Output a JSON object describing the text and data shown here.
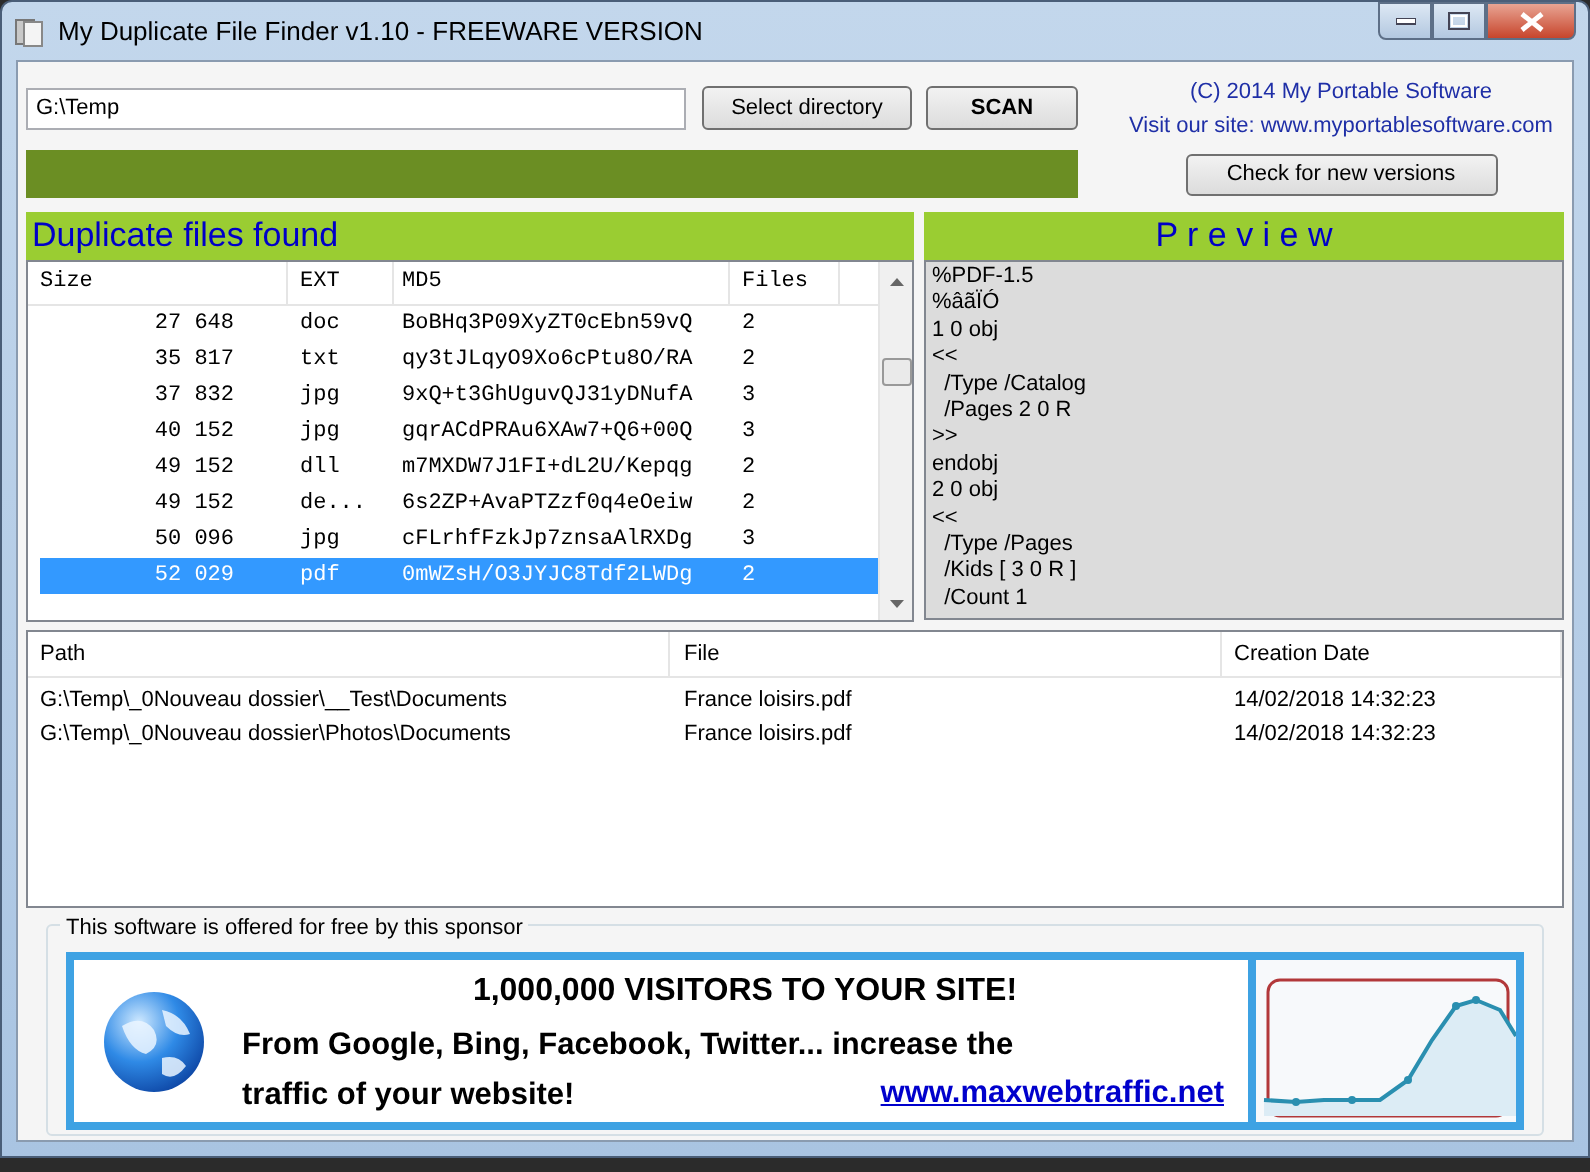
{
  "window": {
    "title": "My Duplicate File Finder v1.10 - FREEWARE VERSION"
  },
  "toolbar": {
    "directory": {
      "value": "G:\\Temp"
    },
    "buttons": [
      {
        "label": "Select directory",
        "kind": "normal"
      },
      {
        "label": "SCAN",
        "kind": "bold"
      }
    ]
  },
  "about": {
    "copyright": "(C) 2014 My Portable Software",
    "site": "Visit our site: www.myportablesoftware.com",
    "check_button": "Check for new versions"
  },
  "progress": {
    "level": 1
  },
  "duplicates": {
    "title": "Duplicate files found",
    "columns": [
      "Size",
      "EXT",
      "MD5",
      "Files"
    ],
    "rows": [
      {
        "size": "27 648",
        "ext": "doc",
        "md5": "BoBHq3P09XyZT0cEbn59vQ",
        "files": "2",
        "selected": false
      },
      {
        "size": "35 817",
        "ext": "txt",
        "md5": "qy3tJLqyO9Xo6cPtu8O/RA",
        "files": "2",
        "selected": false
      },
      {
        "size": "37 832",
        "ext": "jpg",
        "md5": "9xQ+t3GhUguvQJ31yDNufA",
        "files": "3",
        "selected": false
      },
      {
        "size": "40 152",
        "ext": "jpg",
        "md5": "gqrACdPRAu6XAw7+Q6+00Q",
        "files": "3",
        "selected": false
      },
      {
        "size": "49 152",
        "ext": "dll",
        "md5": "m7MXDW7J1FI+dL2U/Kepqg",
        "files": "2",
        "selected": false
      },
      {
        "size": "49 152",
        "ext": "de...",
        "md5": "6s2ZP+AvaPTZzf0q4eOeiw",
        "files": "2",
        "selected": false
      },
      {
        "size": "50 096",
        "ext": "jpg",
        "md5": "cFLrhfFzkJp7znsaAlRXDg",
        "files": "3",
        "selected": false
      },
      {
        "size": "52 029",
        "ext": "pdf",
        "md5": "0mWZsH/O3JYJC8Tdf2LWDg",
        "files": "2",
        "selected": true
      }
    ]
  },
  "preview": {
    "title": "P r e v i e w",
    "lines": [
      "%PDF-1.5",
      "%âãÏÓ",
      "1 0 obj",
      "<<",
      "  /Type /Catalog",
      "  /Pages 2 0 R",
      ">>",
      "endobj",
      "2 0 obj",
      "<<",
      "  /Type /Pages",
      "  /Kids [ 3 0 R ]",
      "  /Count 1"
    ]
  },
  "files": {
    "columns": [
      "Path",
      "File",
      "Creation Date"
    ],
    "rows": [
      [
        "G:\\Temp\\_0Nouveau dossier\\__Test\\Documents",
        "France loisirs.pdf",
        "14/02/2018 14:32:23"
      ],
      [
        "G:\\Temp\\_0Nouveau dossier\\Photos\\Documents",
        "France loisirs.pdf",
        "14/02/2018 14:32:23"
      ]
    ]
  },
  "sponsor": {
    "label": "This software is offered for free by this sponsor",
    "ad": {
      "headline": "1,000,000 VISITORS TO YOUR SITE!",
      "body_lines": [
        "From Google, Bing, Facebook, Twitter... increase the",
        "traffic of your website!"
      ],
      "link": "www.maxwebtraffic.net"
    }
  }
}
